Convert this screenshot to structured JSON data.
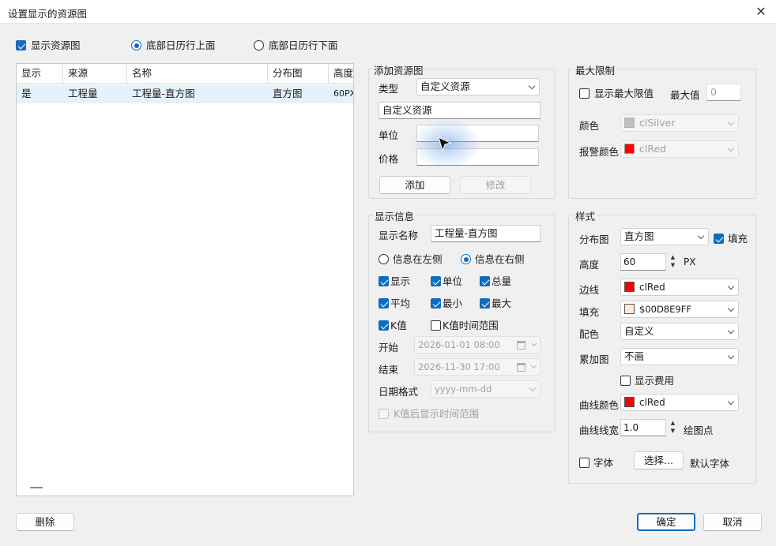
{
  "window": {
    "title": "设置显示的资源图",
    "close_glyph": "✕"
  },
  "top_options": {
    "show_resource_chart": {
      "label": "显示资源图",
      "checked": true
    },
    "bottom_above": {
      "label": "底部日历行上面",
      "selected": true
    },
    "bottom_below": {
      "label": "底部日历行下面",
      "selected": false
    }
  },
  "grid": {
    "columns": [
      "显示",
      "来源",
      "名称",
      "分布图",
      "高度"
    ],
    "rows": [
      {
        "show": "是",
        "source": "工程量",
        "name": "工程量-直方图",
        "dist": "直方图",
        "height": "60PX"
      }
    ]
  },
  "add_resource": {
    "title": "添加资源图",
    "type_label": "类型",
    "type_value": "自定义资源",
    "name_value": "自定义资源",
    "unit_label": "单位",
    "unit_value": "",
    "price_label": "价格",
    "price_value": "",
    "add_button": "添加",
    "modify_button": "修改"
  },
  "max_limit": {
    "title": "最大限制",
    "show_max_label": "显示最大限值",
    "show_max_checked": false,
    "max_label": "最大值",
    "max_value": "0",
    "color_label": "颜色",
    "color_value": "clSilver",
    "color_hex": "#c0c0c0",
    "alarm_label": "报警颜色",
    "alarm_value": "clRed",
    "alarm_hex": "#ff0000"
  },
  "display_info": {
    "title": "显示信息",
    "display_name_label": "显示名称",
    "display_name_value": "工程量-直方图",
    "info_left": "信息在左侧",
    "info_right": "信息在右侧",
    "info_right_selected": true,
    "checks": [
      {
        "label": "显示",
        "checked": true
      },
      {
        "label": "单位",
        "checked": true
      },
      {
        "label": "总量",
        "checked": true
      },
      {
        "label": "平均",
        "checked": true
      },
      {
        "label": "最小",
        "checked": true
      },
      {
        "label": "最大",
        "checked": true
      },
      {
        "label": "K值",
        "checked": true
      },
      {
        "label": "K值时间范围",
        "checked": false
      }
    ],
    "start_label": "开始",
    "start_value": "2026-01-01 08:00",
    "end_label": "结束",
    "end_value": "2026-11-30 17:00",
    "date_format_label": "日期格式",
    "date_format_value": "yyyy-mm-dd",
    "k_after_label": "K值后显示时间范围"
  },
  "style": {
    "title": "样式",
    "dist_label": "分布图",
    "dist_value": "直方图",
    "fill_label": "填充",
    "fill_checked": true,
    "height_label": "高度",
    "height_value": "60",
    "height_unit": "PX",
    "border_label": "边线",
    "border_value": "clRed",
    "border_hex": "#ff0000",
    "fillcolor_label": "填充",
    "fillcolor_value": "$00D8E9FF",
    "fillcolor_hex": "#ffe9d8",
    "palette_label": "配色",
    "palette_value": "自定义",
    "overlay_label": "累加图",
    "overlay_value": "不画",
    "show_cost_label": "显示费用",
    "curve_color_label": "曲线颜色",
    "curve_color_value": "clRed",
    "curve_color_hex": "#ff0000",
    "curve_width_label": "曲线线宽",
    "curve_width_value": "1.0",
    "draw_point_label": "绘图点",
    "font_label": "字体",
    "choose_button": "选择...",
    "default_font_label": "默认字体"
  },
  "footer": {
    "delete_button": "删除",
    "ok_button": "确定",
    "cancel_button": "取消"
  },
  "accent_color": "#0f6cbd"
}
